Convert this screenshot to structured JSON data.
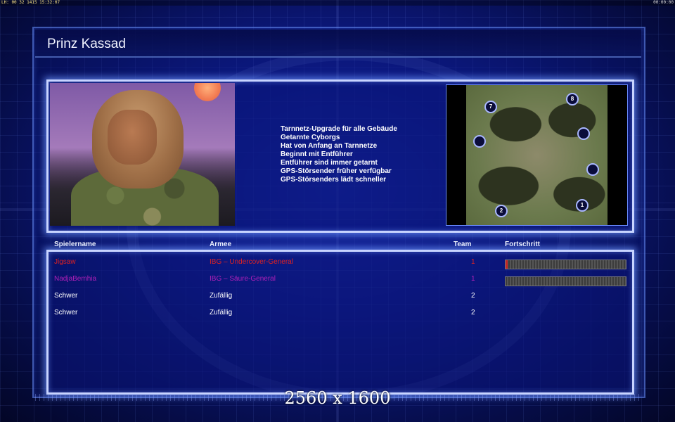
{
  "topbar": {
    "left_text": "LH: 00 32 1415 15:32:07",
    "right_text": "00:00:00"
  },
  "title": "Prinz Kassad",
  "perks": [
    "Tarnnetz-Upgrade für alle Gebäude",
    "Getarnte Cyborgs",
    "Hat von Anfang an Tarnnetze",
    "Beginnt mit Entführer",
    "Entführer sind immer getarnt",
    "GPS-Störsender früher verfügbar",
    "GPS-Störsenders lädt schneller"
  ],
  "map": {
    "markers": [
      "7",
      "8",
      "",
      "",
      "",
      "2",
      "1"
    ]
  },
  "columns": {
    "name": "Spielername",
    "army": "Armee",
    "team": "Team",
    "progress": "Fortschritt"
  },
  "players": [
    {
      "name": "Jigsaw",
      "army": "IBG – Undercover-General",
      "team": "1",
      "color": "#e02222",
      "progress": 0.02,
      "show_progress": true
    },
    {
      "name": "NadjaBemhia",
      "army": "IBG – Säure-General",
      "team": "1",
      "color": "#b020b8",
      "progress": 0.0,
      "show_progress": true
    },
    {
      "name": "Schwer",
      "army": "Zufällig",
      "team": "2",
      "color": "#ffffff",
      "show_progress": false
    },
    {
      "name": "Schwer",
      "army": "Zufällig",
      "team": "2",
      "color": "#ffffff",
      "show_progress": false
    }
  ],
  "resolution_text": "2560 x 1600"
}
